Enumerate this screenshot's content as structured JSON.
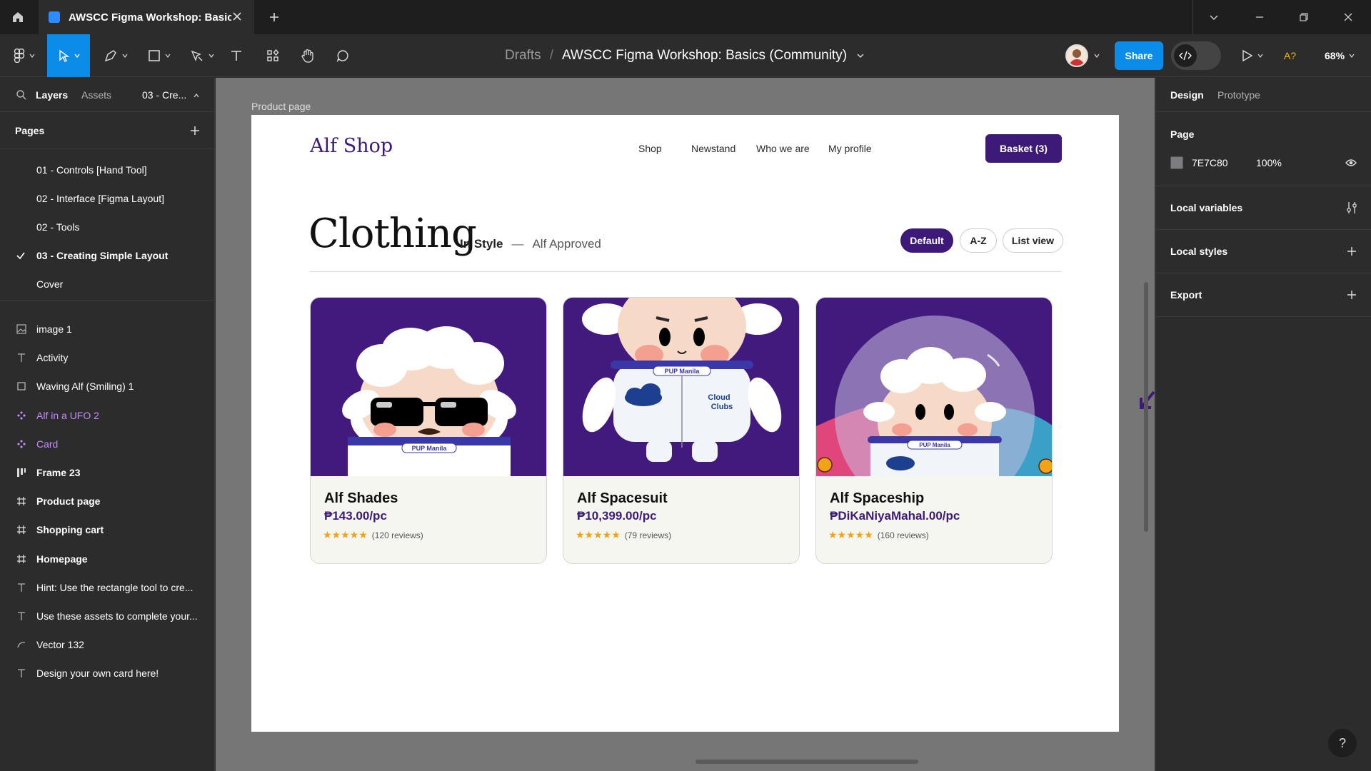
{
  "window": {
    "tab_title": "AWSCC Figma Workshop: Basics (Community)"
  },
  "toolbar": {
    "breadcrumb_drafts": "Drafts",
    "breadcrumb_sep": "/",
    "file_name": "AWSCC Figma Workshop: Basics (Community)",
    "share_label": "Share",
    "missing_fonts": "A?",
    "zoom": "68%"
  },
  "left_panel": {
    "tab_layers": "Layers",
    "tab_assets": "Assets",
    "current_page": "03 - Cre...",
    "pages_header": "Pages",
    "pages": [
      {
        "label": "01 - Controls [Hand Tool]"
      },
      {
        "label": "02 - Interface [Figma Layout]"
      },
      {
        "label": "02 - Tools"
      },
      {
        "label": "03 - Creating Simple Layout",
        "current": true
      },
      {
        "label": "Cover"
      }
    ],
    "layers": [
      {
        "label": "image 1",
        "icon": "image-icon"
      },
      {
        "label": "Activity",
        "icon": "text-icon"
      },
      {
        "label": "Waving Alf (Smiling) 1",
        "icon": "rectangle-icon"
      },
      {
        "label": "Alf in a UFO 2",
        "icon": "component-icon"
      },
      {
        "label": "Card",
        "icon": "component-icon"
      },
      {
        "label": "Frame 23",
        "icon": "auto-layout-icon"
      },
      {
        "label": "Product page",
        "icon": "frame-icon"
      },
      {
        "label": "Shopping cart",
        "icon": "frame-icon"
      },
      {
        "label": "Homepage",
        "icon": "frame-icon"
      },
      {
        "label": "Hint: Use the rectangle tool to cre...",
        "icon": "text-icon"
      },
      {
        "label": "Use these assets to complete your...",
        "icon": "text-icon"
      },
      {
        "label": "Vector 132",
        "icon": "vector-icon"
      },
      {
        "label": "Design your own card here!",
        "icon": "text-icon"
      }
    ]
  },
  "canvas": {
    "frame_label": "Product page"
  },
  "shop": {
    "brand": "Alf Shop",
    "nav": [
      "Shop",
      "Newstand",
      "Who we are",
      "My profile"
    ],
    "basket": "Basket (3)",
    "heading": "Clothing",
    "in_style": "In Style",
    "dash": "—",
    "approved": "Alf Approved",
    "sort": [
      "Default",
      "A-Z",
      "List view"
    ],
    "products": [
      {
        "name": "Alf Shades",
        "price": "₱143.00/pc",
        "stars": "★★★★★",
        "reviews": "(120 reviews)",
        "rating": 5
      },
      {
        "name": "Alf Spacesuit",
        "price": "₱10,399.00/pc",
        "stars": "★★★★★",
        "reviews": "(79 reviews)",
        "rating": 5
      },
      {
        "name": "Alf Spaceship",
        "price": "₱DiKaNiyaMahal.00/pc",
        "stars": "★★★★★",
        "reviews": "(160 reviews)",
        "rating": 5
      }
    ],
    "suit_badge": "PUP Manila",
    "cloud_label_1": "Cloud",
    "cloud_label_2": "Clubs"
  },
  "right_panel": {
    "tab_design": "Design",
    "tab_prototype": "Prototype",
    "page_title": "Page",
    "page_color": "7E7C80",
    "page_opacity": "100%",
    "local_variables": "Local variables",
    "local_styles": "Local styles",
    "export": "Export"
  },
  "help": "?",
  "colors": {
    "accent": "#0c8ce9",
    "brand_purple": "#3d1a78",
    "component_purple": "#c48bff",
    "star": "#f0a319"
  }
}
